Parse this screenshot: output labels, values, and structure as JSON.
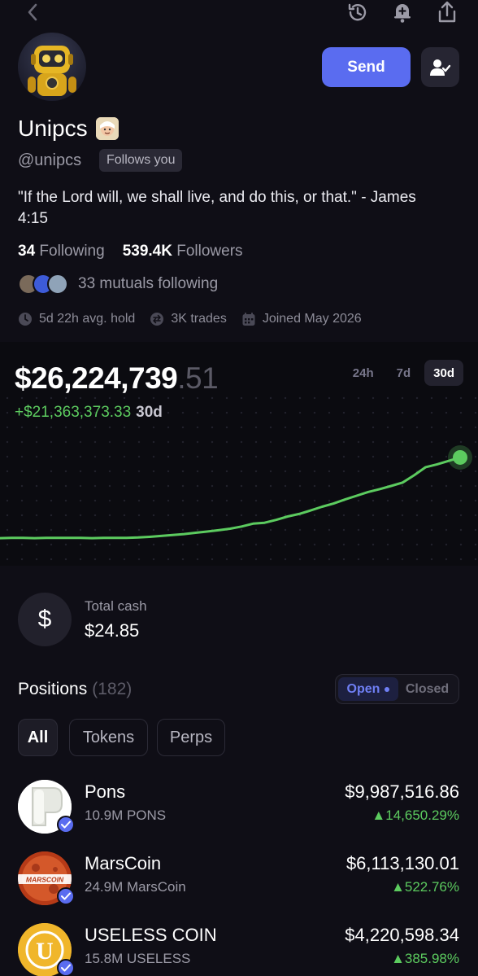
{
  "profile": {
    "name": "Unipcs",
    "handle": "@unipcs",
    "follows_badge": "Follows you",
    "bio": "\"If the Lord will, we shall live, and do this, or that.\" - James 4:15",
    "following_count": "34",
    "following_label": "Following",
    "followers_count": "539.4K",
    "followers_label": "Followers",
    "mutuals_text": "33 mutuals following",
    "avg_hold": "5d 22h avg. hold",
    "trades": "3K trades",
    "joined": "Joined May 2026"
  },
  "actions": {
    "send_label": "Send"
  },
  "portfolio": {
    "value_whole": "$26,224,739",
    "value_cents": ".51",
    "change_amount": "+$21,363,373.33",
    "change_period": "30d",
    "ranges": [
      "24h",
      "7d",
      "30d"
    ],
    "active_range": "30d"
  },
  "chart_data": {
    "type": "line",
    "x": [
      0,
      1,
      2,
      3,
      4,
      5,
      6,
      7,
      8,
      9,
      10,
      11,
      12,
      13,
      14,
      15,
      16,
      17,
      18,
      19,
      20,
      21,
      22,
      23,
      24,
      25,
      26,
      27,
      28,
      29,
      30,
      31,
      32,
      33,
      34,
      35,
      36,
      37,
      38,
      39,
      40
    ],
    "values": [
      0.5,
      0.6,
      0.6,
      0.5,
      0.6,
      0.6,
      0.6,
      0.6,
      0.5,
      0.6,
      0.6,
      0.6,
      0.7,
      0.9,
      1.2,
      1.5,
      1.8,
      2.2,
      2.6,
      3.0,
      3.5,
      4.2,
      5.1,
      5.4,
      6.3,
      7.4,
      8.2,
      9.3,
      10.5,
      11.5,
      12.8,
      14.0,
      15.2,
      16.1,
      17.1,
      18.2,
      20.5,
      23.1,
      24.0,
      25.1,
      26.2
    ],
    "ylim": [
      0,
      28
    ],
    "color": "#5ccb5f",
    "grid": false
  },
  "cash": {
    "label": "Total cash",
    "value": "$24.85"
  },
  "positions": {
    "title": "Positions",
    "count": "(182)",
    "toggle_open": "Open",
    "toggle_closed": "Closed",
    "filters": [
      "All",
      "Tokens",
      "Perps"
    ],
    "items": [
      {
        "name": "Pons",
        "amount": "10.9M PONS",
        "value": "$9,987,516.86",
        "change": "▲14,650.29%",
        "icon": "pons-icon"
      },
      {
        "name": "MarsCoin",
        "amount": "24.9M MarsCoin",
        "value": "$6,113,130.01",
        "change": "▲522.76%",
        "icon": "marscoin-icon",
        "icon_text": "MARSCOIN"
      },
      {
        "name": "USELESS COIN",
        "amount": "15.8M USELESS",
        "value": "$4,220,598.34",
        "change": "▲385.98%",
        "icon": "useless-coin-icon",
        "icon_text": "U"
      }
    ]
  },
  "colors": {
    "accent": "#5a6cf0",
    "positive": "#5ccb5f",
    "background": "#0f0e16"
  }
}
